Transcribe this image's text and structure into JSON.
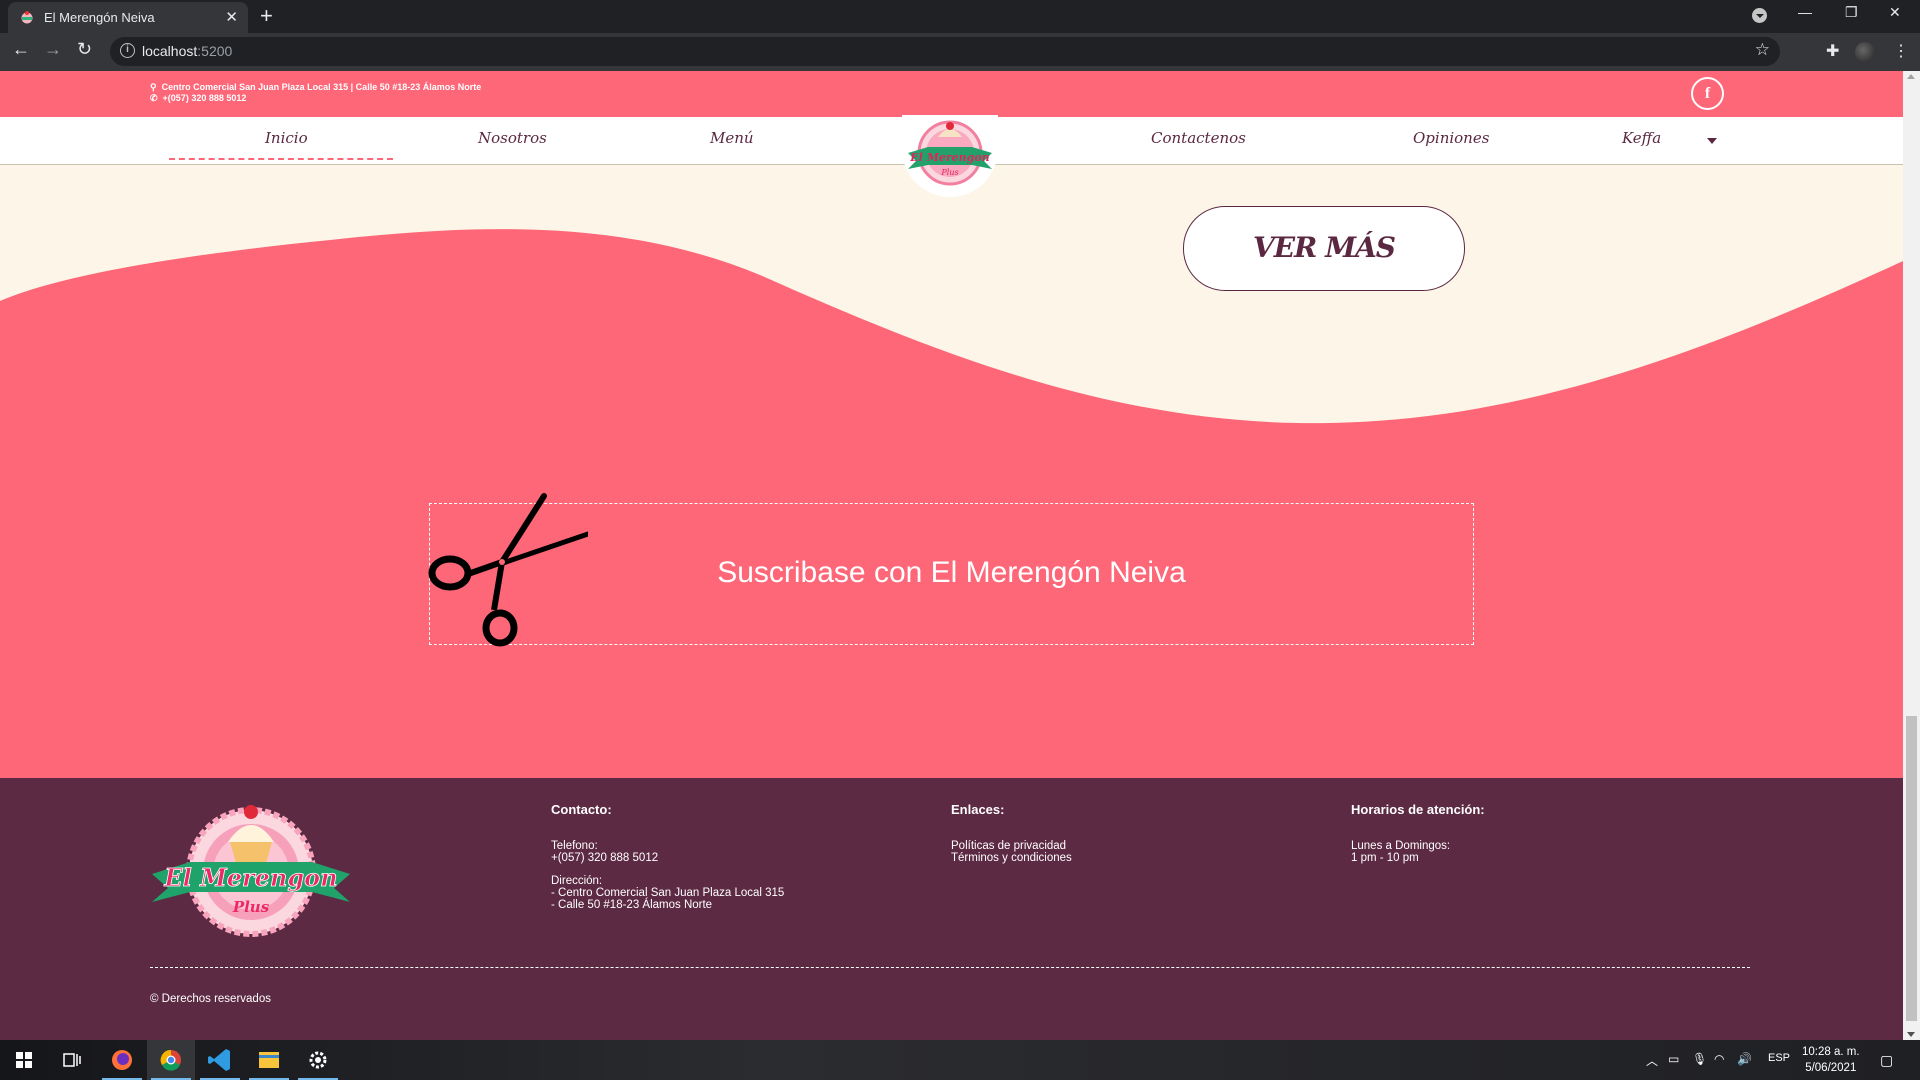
{
  "browser": {
    "tab_title": "El Merengón Neiva",
    "url_host": "localhost",
    "url_port": ":5200"
  },
  "topbar": {
    "address": "Centro Comercial San Juan Plaza Local 315 | Calle 50 #18-23 Álamos Norte",
    "phone": "+(057) 320 888 5012",
    "facebook": "f"
  },
  "nav": {
    "items": [
      "Inicio",
      "Nosotros",
      "Menú",
      "Contactenos",
      "Opiniones",
      "Keffa"
    ],
    "active": "Inicio"
  },
  "hero": {
    "more_button": "VER MÁS"
  },
  "subscribe": {
    "text": "Suscribase con El Merengón Neiva"
  },
  "footer": {
    "contact_title": "Contacto:",
    "phone_label": "Telefono:",
    "phone": "+(057) 320 888 5012",
    "address_label": "Dirección:",
    "address_1": "- Centro Comercial San Juan Plaza Local 315",
    "address_2": "- Calle 50 #18-23 Álamos Norte",
    "links_title": "Enlaces:",
    "link_privacy": "Políticas de privacidad",
    "link_terms": "Términos y condiciones",
    "hours_title": "Horarios de atención:",
    "hours_days": "Lunes a Domingos:",
    "hours_time": "1 pm - 10 pm",
    "copyright": "© Derechos reservados",
    "logo_text_1": "El Merengon",
    "logo_text_2": "Plus"
  },
  "taskbar": {
    "language": "ESP",
    "time": "10:28 a. m.",
    "date": "5/06/2021"
  },
  "colors": {
    "brand_pink": "#fd6778",
    "brand_plum": "#5c2a43",
    "cream": "#fdf6e8"
  }
}
